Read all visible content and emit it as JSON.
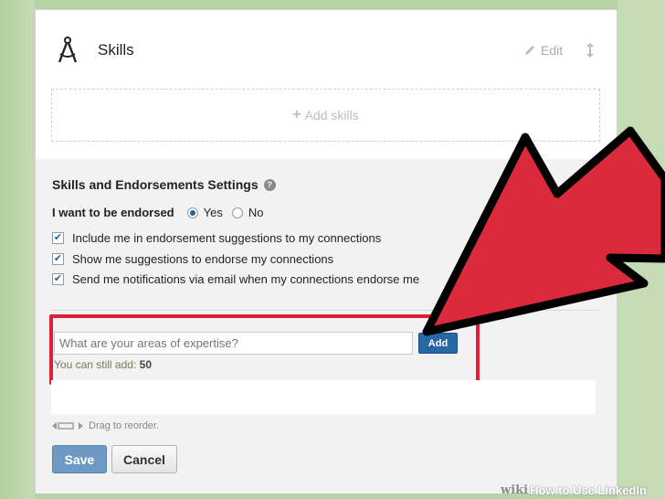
{
  "skills_section": {
    "title": "Skills",
    "icon": "compass-icon",
    "edit_label": "Edit",
    "add_skills_label": "Add skills"
  },
  "settings": {
    "title": "Skills and Endorsements Settings",
    "endorse_question": "I want to be endorsed",
    "option_yes": "Yes",
    "option_no": "No",
    "selected": "Yes",
    "checkboxes": [
      {
        "label": "Include me in endorsement suggestions to my connections",
        "checked": true
      },
      {
        "label": "Show me suggestions to endorse my connections",
        "checked": true
      },
      {
        "label": "Send me notifications via email when my connections endorse me",
        "checked": true
      }
    ]
  },
  "add_skill_form": {
    "placeholder": "What are your areas of expertise?",
    "add_label": "Add",
    "remaining_prefix": "You can still add:",
    "remaining_count": "50"
  },
  "drag_hint": "Drag to reorder.",
  "actions": {
    "save_label": "Save",
    "cancel_label": "Cancel"
  },
  "watermark": {
    "brand": "wiki",
    "title": "How to Use LinkedIn"
  },
  "colors": {
    "highlight": "#e11e38",
    "arrow": "#dc2a3d",
    "background": "#b7d3a4",
    "primary_button": "#2867a6"
  }
}
